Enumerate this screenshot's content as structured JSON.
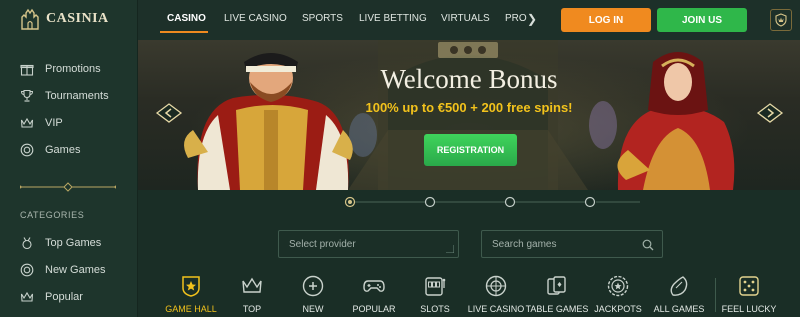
{
  "logo": {
    "text": "CASINIA"
  },
  "sidebar": {
    "items": [
      {
        "label": "Promotions",
        "icon": "gift-icon"
      },
      {
        "label": "Tournaments",
        "icon": "trophy-icon"
      },
      {
        "label": "VIP",
        "icon": "crown-icon"
      },
      {
        "label": "Games",
        "icon": "chip-icon"
      }
    ],
    "categories_heading": "CATEGORIES",
    "category_items": [
      {
        "label": "Top Games",
        "icon": "medal-icon"
      },
      {
        "label": "New Games",
        "icon": "chip-icon"
      },
      {
        "label": "Popular",
        "icon": "crown-icon"
      }
    ]
  },
  "nav": {
    "links": [
      "CASINO",
      "LIVE CASINO",
      "SPORTS",
      "LIVE BETTING",
      "VIRTUALS",
      "PRO"
    ],
    "active": "CASINO",
    "login": "LOG IN",
    "join": "JOIN US"
  },
  "banner": {
    "title": "Welcome Bonus",
    "subtitle": "100% up to €500 + 200 free spins!",
    "cta": "REGISTRATION",
    "slides_total": 4,
    "active_slide": 1
  },
  "filters": {
    "provider_placeholder": "Select provider",
    "search_placeholder": "Search games"
  },
  "game_categories": [
    {
      "label": "GAME HALL",
      "icon": "shield-star-icon",
      "active": true
    },
    {
      "label": "TOP",
      "icon": "crown-icon"
    },
    {
      "label": "NEW",
      "icon": "new-chip-icon"
    },
    {
      "label": "POPULAR",
      "icon": "gamepad-icon"
    },
    {
      "label": "SLOTS",
      "icon": "slot-machine-icon"
    },
    {
      "label": "LIVE CASINO",
      "icon": "roulette-icon"
    },
    {
      "label": "TABLE GAMES",
      "icon": "cards-icon"
    },
    {
      "label": "JACKPOTS",
      "icon": "jackpot-coin-icon"
    },
    {
      "label": "ALL GAMES",
      "icon": "fruit-icon"
    },
    {
      "label": "FEEL LUCKY",
      "icon": "dice-icon"
    }
  ],
  "colors": {
    "accent_orange": "#f08a1f",
    "accent_green": "#2fb74a",
    "accent_gold": "#f2c21c",
    "background": "#1a2e26"
  }
}
